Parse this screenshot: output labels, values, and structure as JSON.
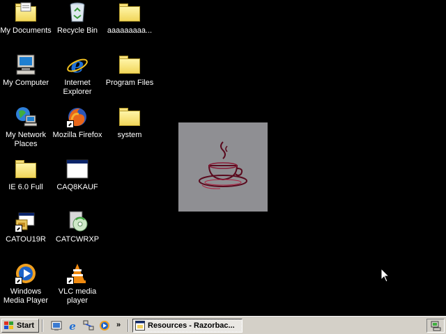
{
  "desktop": {
    "background_color": "#000000",
    "icons": [
      {
        "label": "My Documents",
        "icon": "my-documents-icon"
      },
      {
        "label": "Recycle Bin",
        "icon": "recycle-bin-icon"
      },
      {
        "label": "aaaaaaaaa...",
        "icon": "folder-icon"
      },
      {
        "label": "My Computer",
        "icon": "my-computer-icon"
      },
      {
        "label": "Internet Explorer",
        "icon": "internet-explorer-icon"
      },
      {
        "label": "Program Files",
        "icon": "folder-icon"
      },
      {
        "label": "My Network Places",
        "icon": "network-places-icon"
      },
      {
        "label": "Mozilla Firefox",
        "icon": "firefox-icon"
      },
      {
        "label": "system",
        "icon": "folder-icon"
      },
      {
        "label": "IE 6.0 Full",
        "icon": "folder-icon"
      },
      {
        "label": "CAQ8KAUF",
        "icon": "window-icon"
      },
      {
        "label": "CATOU19R",
        "icon": "installer-icon"
      },
      {
        "label": "CATCWRXP",
        "icon": "cd-installer-icon"
      },
      {
        "label": "Windows Media Player",
        "icon": "media-player-icon"
      },
      {
        "label": "VLC media player",
        "icon": "vlc-icon"
      }
    ]
  },
  "center_image": {
    "icon": "coffee-cup-image"
  },
  "taskbar": {
    "start_label": "Start",
    "quick_launch": [
      "show-desktop-icon",
      "internet-explorer-icon",
      "network-icon",
      "media-player-icon"
    ],
    "overflow_label": "»",
    "tasks": [
      {
        "label": "Resources - Razorbac...",
        "icon": "explorer-window-icon",
        "active": true
      }
    ],
    "tray_icons": [
      "tray-network-icon"
    ]
  }
}
